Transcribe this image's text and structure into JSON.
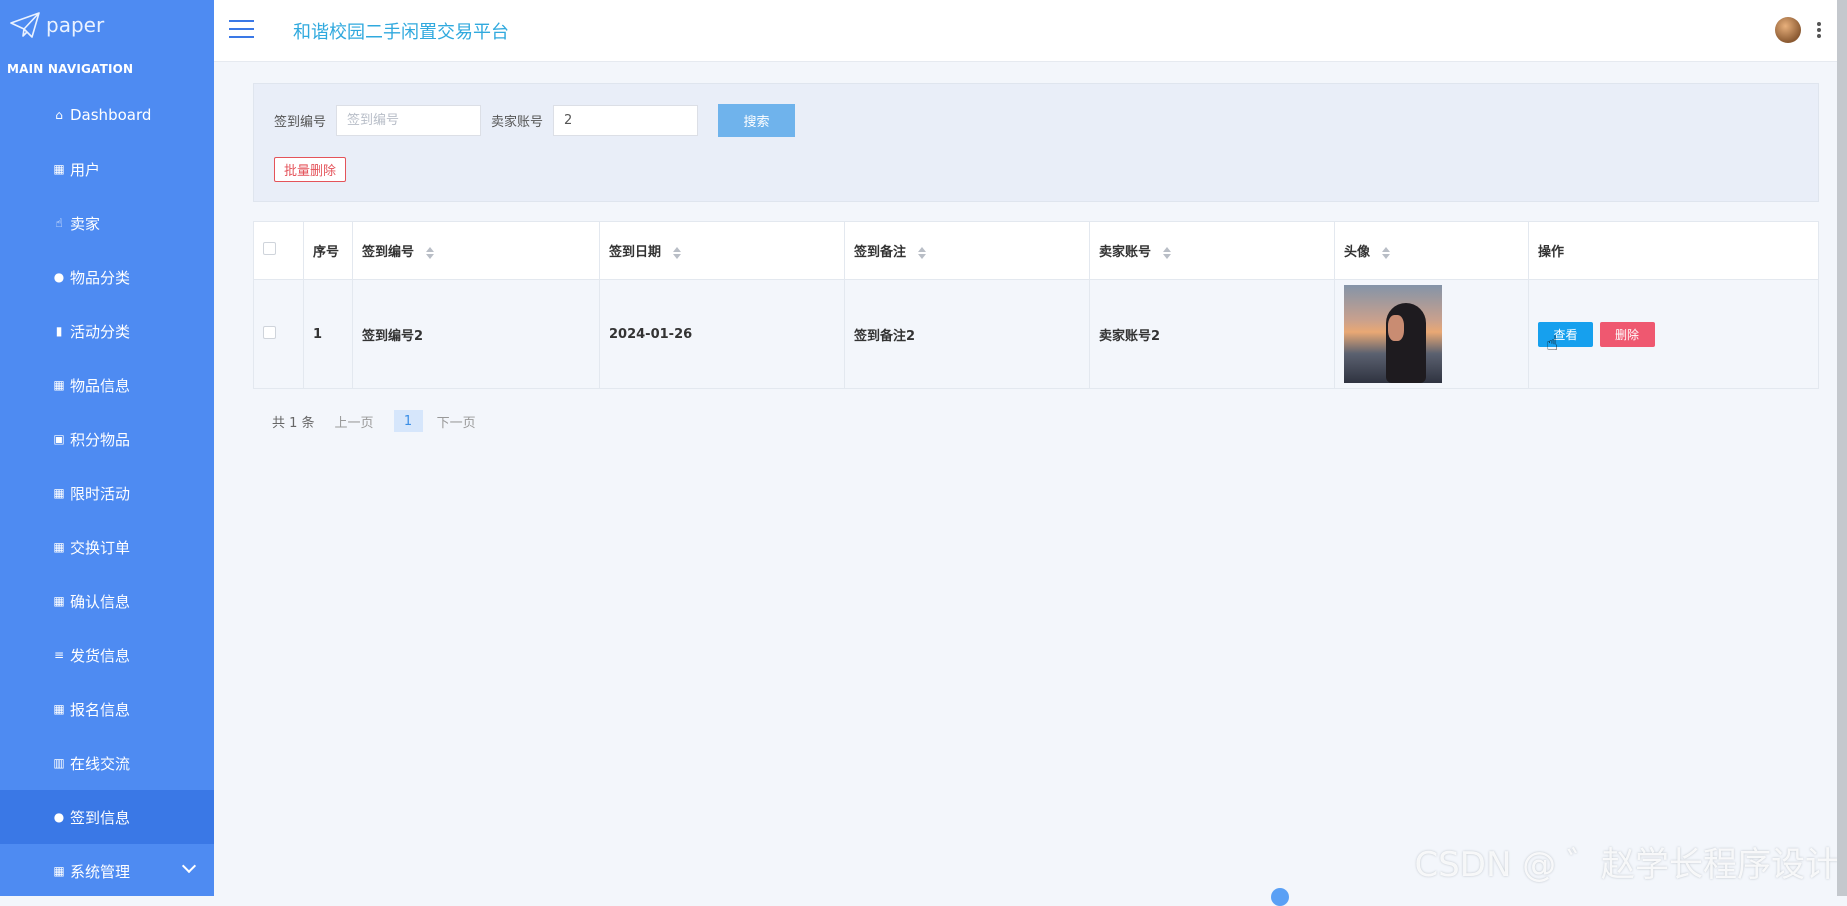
{
  "brand": {
    "logo_text": "paper"
  },
  "sidebar": {
    "nav_title": "MAIN NAVIGATION",
    "items": [
      {
        "label": "Dashboard",
        "icon": "home-icon"
      },
      {
        "label": "用户",
        "icon": "grid-icon"
      },
      {
        "label": "卖家",
        "icon": "thumbs-up-icon"
      },
      {
        "label": "物品分类",
        "icon": "map-pin-icon"
      },
      {
        "label": "活动分类",
        "icon": "bar-chart-icon"
      },
      {
        "label": "物品信息",
        "icon": "grid-icon"
      },
      {
        "label": "积分物品",
        "icon": "clipboard-icon"
      },
      {
        "label": "限时活动",
        "icon": "grid-icon"
      },
      {
        "label": "交换订单",
        "icon": "grid-icon"
      },
      {
        "label": "确认信息",
        "icon": "grid-icon"
      },
      {
        "label": "发货信息",
        "icon": "list-icon"
      },
      {
        "label": "报名信息",
        "icon": "grid-icon"
      },
      {
        "label": "在线交流",
        "icon": "book-icon"
      },
      {
        "label": "签到信息",
        "icon": "user-icon",
        "active": true
      },
      {
        "label": "系统管理",
        "icon": "grid-icon"
      }
    ]
  },
  "header": {
    "title": "和谐校园二手闲置交易平台"
  },
  "search": {
    "field1_label": "签到编号",
    "field1_placeholder": "签到编号",
    "field1_value": "",
    "field2_label": "卖家账号",
    "field2_placeholder": "卖家账号",
    "field2_value": "2",
    "search_button": "搜索",
    "batch_delete_button": "批量删除"
  },
  "table": {
    "columns": [
      "序号",
      "签到编号",
      "签到日期",
      "签到备注",
      "卖家账号",
      "头像",
      "操作"
    ],
    "rows": [
      {
        "index": "1",
        "sign_no": "签到编号2",
        "sign_date": "2024-01-26",
        "sign_note": "签到备注2",
        "seller_account": "卖家账号2",
        "view_label": "查看",
        "delete_label": "删除"
      }
    ]
  },
  "pagination": {
    "total": "共 1 条",
    "prev": "上一页",
    "page": "1",
    "next": "下一页"
  },
  "watermark": "CSDN @ ゛赵学长程序设计",
  "colors": {
    "sidebar": "#4e8bf2",
    "sidebar_active": "#3a78e6",
    "title": "#30a9de",
    "search_button": "#6fb3ec",
    "view_button": "#16a0ee",
    "delete_button": "#ef5870"
  }
}
